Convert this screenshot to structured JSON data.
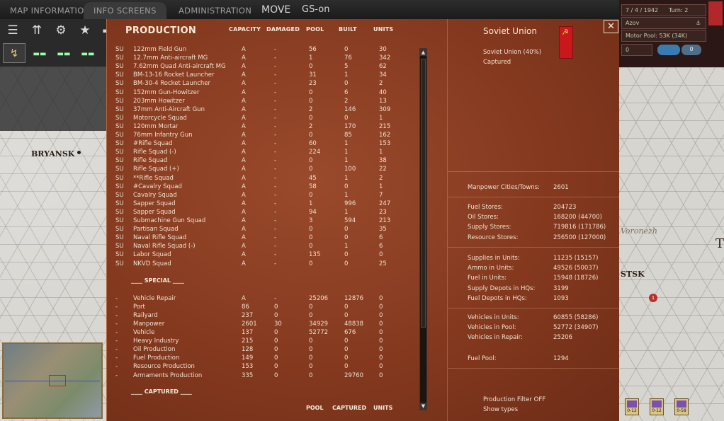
{
  "topbar": {
    "tabs": [
      "MAP INFORMATION",
      "INFO SCREENS",
      "ADMINISTRATION"
    ],
    "mode": "MOVE",
    "status": "GS-on"
  },
  "hud": {
    "date": "7 / 4 / 1942",
    "turn": "Turn: 2",
    "location": "Azov",
    "motor_pool": "Motor Pool: 53K (34K)",
    "value_field": "0",
    "toggle_label": "0"
  },
  "map": {
    "city_left": "BRYANSK",
    "city_right": "Voronezh",
    "city_right2": "STSK",
    "edge_letter": "T",
    "marker": "1",
    "counters": [
      "0-12",
      "0-12",
      "0-58"
    ]
  },
  "production": {
    "title": "PRODUCTION",
    "headers": {
      "capacity": "CAPACITY",
      "damaged": "DAMAGED",
      "pool": "POOL",
      "built": "BUILT",
      "units": "UNITS"
    },
    "items": [
      [
        "SU",
        "122mm Field Gun",
        "A",
        "-",
        "56",
        "0",
        "30"
      ],
      [
        "SU",
        "12.7mm Anti-aircraft MG",
        "A",
        "-",
        "1",
        "76",
        "342"
      ],
      [
        "SU",
        "7.62mm Quad Anti-aircraft MG",
        "A",
        "-",
        "0",
        "5",
        "62"
      ],
      [
        "SU",
        "BM-13-16 Rocket Launcher",
        "A",
        "-",
        "31",
        "1",
        "34"
      ],
      [
        "SU",
        "BM-30-4 Rocket Launcher",
        "A",
        "-",
        "23",
        "0",
        "2"
      ],
      [
        "SU",
        "152mm Gun-Howitzer",
        "A",
        "-",
        "0",
        "6",
        "40"
      ],
      [
        "SU",
        "203mm Howitzer",
        "A",
        "-",
        "0",
        "2",
        "13"
      ],
      [
        "SU",
        "37mm Anti-Aircraft Gun",
        "A",
        "-",
        "2",
        "146",
        "309"
      ],
      [
        "SU",
        "Motorcycle Squad",
        "A",
        "-",
        "0",
        "0",
        "1"
      ],
      [
        "SU",
        "120mm Mortar",
        "A",
        "-",
        "2",
        "170",
        "215"
      ],
      [
        "SU",
        "76mm Infantry Gun",
        "A",
        "-",
        "0",
        "85",
        "162"
      ],
      [
        "SU",
        "#Rifle Squad",
        "A",
        "-",
        "60",
        "1",
        "153"
      ],
      [
        "SU",
        "Rifle Squad (-)",
        "A",
        "-",
        "224",
        "1",
        "1"
      ],
      [
        "SU",
        "Rifle Squad",
        "A",
        "-",
        "0",
        "1",
        "38"
      ],
      [
        "SU",
        "Rifle Squad (+)",
        "A",
        "-",
        "0",
        "100",
        "22"
      ],
      [
        "SU",
        "**Rifle Squad",
        "A",
        "-",
        "45",
        "1",
        "2"
      ],
      [
        "SU",
        "#Cavalry Squad",
        "A",
        "-",
        "58",
        "0",
        "1"
      ],
      [
        "SU",
        "Cavalry Squad",
        "A",
        "-",
        "0",
        "1",
        "7"
      ],
      [
        "SU",
        "Sapper Squad",
        "A",
        "-",
        "1",
        "996",
        "247"
      ],
      [
        "SU",
        "Sapper Squad",
        "A",
        "-",
        "94",
        "1",
        "23"
      ],
      [
        "SU",
        "Submachine Gun Squad",
        "A",
        "-",
        "3",
        "594",
        "213"
      ],
      [
        "SU",
        "Partisan Squad",
        "A",
        "-",
        "0",
        "0",
        "35"
      ],
      [
        "SU",
        "Naval Rifle Squad",
        "A",
        "-",
        "0",
        "0",
        "6"
      ],
      [
        "SU",
        "Naval Rifle Squad (-)",
        "A",
        "-",
        "0",
        "1",
        "6"
      ],
      [
        "SU",
        "Labor Squad",
        "A",
        "-",
        "135",
        "0",
        "0"
      ],
      [
        "SU",
        "NKVD Squad",
        "A",
        "-",
        "0",
        "0",
        "25"
      ]
    ],
    "special_label": "____ SPECIAL ____",
    "special": [
      [
        "-",
        "Vehicle Repair",
        "A",
        "-",
        "25206",
        "12876",
        "0"
      ],
      [
        "-",
        "Port",
        "86",
        "0",
        "0",
        "0",
        "0"
      ],
      [
        "-",
        "Railyard",
        "237",
        "0",
        "0",
        "0",
        "0"
      ],
      [
        "-",
        "Manpower",
        "2601",
        "30",
        "34929",
        "48838",
        "0"
      ],
      [
        "-",
        "Vehicle",
        "137",
        "0",
        "52772",
        "676",
        "0"
      ],
      [
        "-",
        "Heavy Industry",
        "215",
        "0",
        "0",
        "0",
        "0"
      ],
      [
        "-",
        "Oil Production",
        "128",
        "0",
        "0",
        "0",
        "0"
      ],
      [
        "-",
        "Fuel Production",
        "149",
        "0",
        "0",
        "0",
        "0"
      ],
      [
        "-",
        "Resource Production",
        "153",
        "0",
        "0",
        "0",
        "0"
      ],
      [
        "-",
        "Armaments Production",
        "335",
        "0",
        "0",
        "29760",
        "0"
      ]
    ],
    "captured_label": "____ CAPTURED ____",
    "footer_headers": {
      "pool": "POOL",
      "captured": "CAPTURED",
      "units": "UNITS"
    }
  },
  "nation": {
    "name": "Soviet Union",
    "flag_icon": "hammer-sickle-icon",
    "share": "Soviet Union  (40%)",
    "captured": "Captured"
  },
  "stats": {
    "manpower": [
      [
        "Manpower Cities/Towns:",
        "2601"
      ]
    ],
    "stores": [
      [
        "Fuel Stores:",
        "204723"
      ],
      [
        "Oil Stores:",
        "168200 (44700)"
      ],
      [
        "Supply Stores:",
        "719816 (171786)"
      ],
      [
        "Resource Stores:",
        "256500 (127000)"
      ]
    ],
    "units": [
      [
        "Supplies in Units:",
        "11235 (15157)"
      ],
      [
        "Ammo in Units:",
        "49526 (50037)"
      ],
      [
        "Fuel in Units:",
        "15948 (18726)"
      ],
      [
        "Supply Depots in HQs:",
        "3199"
      ],
      [
        "Fuel Depots in HQs:",
        "1093"
      ]
    ],
    "vehicles": [
      [
        "Vehicles in Units:",
        "60855 (58286)"
      ],
      [
        "Vehicles in Pool:",
        "52772 (34907)"
      ],
      [
        "Vehicles in Repair:",
        "25206"
      ]
    ],
    "fuel_pool": [
      [
        "Fuel Pool:",
        "1294"
      ]
    ]
  },
  "filter": {
    "production_filter": "Production Filter OFF",
    "show_types": "Show types"
  },
  "close_glyph": "✕"
}
